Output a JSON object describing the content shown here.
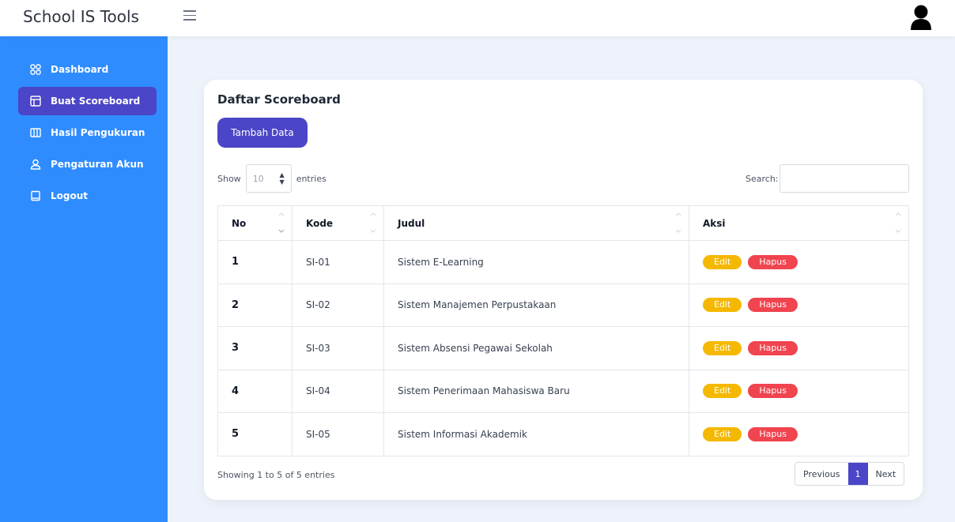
{
  "app": {
    "title": "School IS Tools"
  },
  "sidebar": {
    "items": [
      {
        "label": "Dashboard",
        "icon": "grid-icon",
        "active": false
      },
      {
        "label": "Buat Scoreboard",
        "icon": "layout-icon",
        "active": true
      },
      {
        "label": "Hasil Pengukuran",
        "icon": "columns-icon",
        "active": false
      },
      {
        "label": "Pengaturan Akun",
        "icon": "user-icon",
        "active": false
      },
      {
        "label": "Logout",
        "icon": "door-icon",
        "active": false
      }
    ]
  },
  "main": {
    "title": "Daftar Scoreboard",
    "add_button": "Tambah Data",
    "show_label": "Show",
    "entries_value": "10",
    "entries_label": "entries",
    "search_label": "Search:",
    "search_value": "",
    "columns": [
      "No",
      "Kode",
      "Judul",
      "Aksi"
    ],
    "rows": [
      {
        "no": "1",
        "kode": "SI-01",
        "judul": "Sistem E-Learning"
      },
      {
        "no": "2",
        "kode": "SI-02",
        "judul": "Sistem Manajemen Perpustakaan"
      },
      {
        "no": "3",
        "kode": "SI-03",
        "judul": "Sistem Absensi Pegawai Sekolah"
      },
      {
        "no": "4",
        "kode": "SI-04",
        "judul": "Sistem Penerimaan Mahasiswa Baru"
      },
      {
        "no": "5",
        "kode": "SI-05",
        "judul": "Sistem Informasi Akademik"
      }
    ],
    "edit_label": "Edit",
    "delete_label": "Hapus",
    "info": "Showing 1 to 5 of 5 entries",
    "pagination": {
      "previous": "Previous",
      "current": "1",
      "next": "Next"
    }
  },
  "colors": {
    "sidebar_bg": "#2f8cff",
    "accent": "#4b45c7",
    "edit_badge": "#f5b800",
    "delete_badge": "#f0444f"
  }
}
